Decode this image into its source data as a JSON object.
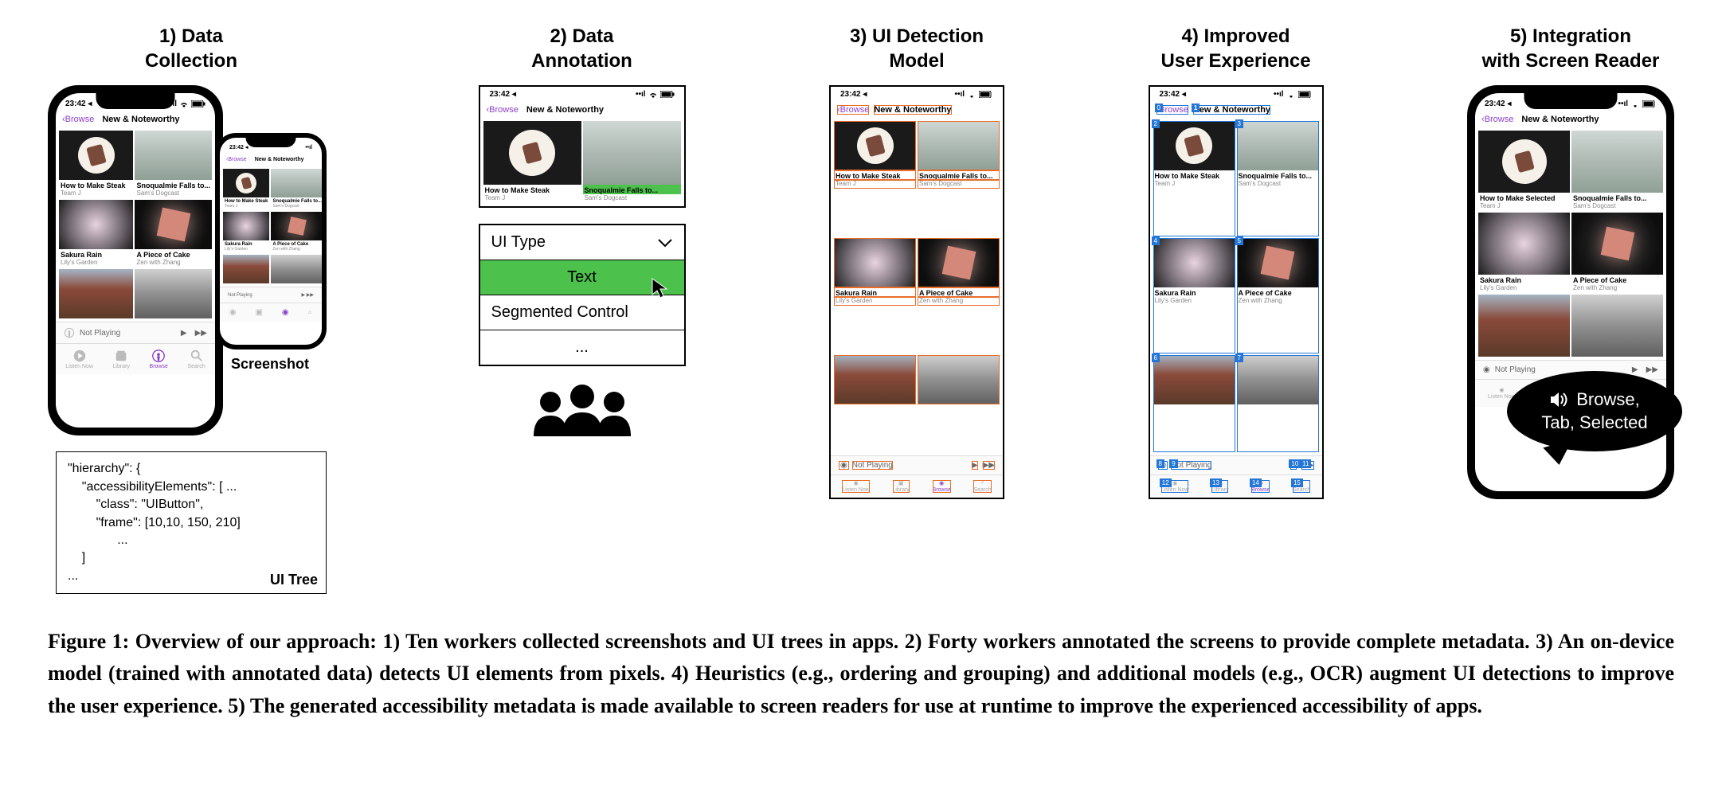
{
  "headers": {
    "c1": "1) Data\nCollection",
    "c2": "2) Data\nAnnotation",
    "c3": "3) UI Detection\nModel",
    "c4": "4) Improved\nUser Experience",
    "c5": "5) Integration\nwith Screen Reader"
  },
  "status": {
    "time": "23:42 ◂",
    "signal": "••ıl",
    "wifi": "⌃",
    "battery": "■"
  },
  "nav": {
    "back": "Browse",
    "title": "New & Noteworthy"
  },
  "cells": [
    {
      "title": "How to Make Steak",
      "sub": "Team J"
    },
    {
      "title": "Snoqualmie Falls to...",
      "sub": "Sam's Dogcast"
    },
    {
      "title": "Sakura Rain",
      "sub": "Lily's Garden"
    },
    {
      "title": "A Piece of Cake",
      "sub": "Zen with Zhang"
    }
  ],
  "cells_sel": {
    "title": "How to Make Selected",
    "sub": "Team J"
  },
  "now_playing": "Not Playing",
  "tabs": [
    {
      "label": "Listen Now"
    },
    {
      "label": "Library"
    },
    {
      "label": "Browse"
    },
    {
      "label": "Search"
    }
  ],
  "screenshot_label": "Screenshot",
  "ui_tree": {
    "line1": "\"hierarchy\": {",
    "line2": "    \"accessibilityElements\": [ ...",
    "line3": "        \"class\": \"UIButton\",",
    "line4": "        \"frame\": [10,10, 150, 210]",
    "line5": "              ...",
    "line6": "    ]",
    "line7": "...",
    "label": "UI Tree"
  },
  "dropdown": {
    "header": "UI Type",
    "option_text": "Text",
    "option_segmented": "Segmented Control",
    "more": "..."
  },
  "numbers": {
    "n0": "0",
    "n1": "1",
    "n2": "2",
    "n3": "3",
    "n4": "4",
    "n5": "5",
    "n6": "6",
    "n7": "7",
    "n8": "8",
    "n9": "9",
    "n10": "10",
    "n11": "11",
    "n12": "12",
    "n13": "13",
    "n14": "14",
    "n15": "15"
  },
  "bubble": {
    "line1": "Browse,",
    "line2": "Tab, Selected"
  },
  "caption_prefix": "Figure 1: Overview of our approach: ",
  "caption_body": "1) Ten workers collected screenshots and UI trees in apps. 2) Forty workers annotated the screens to provide complete metadata. 3) An on-device model (trained with annotated data) detects UI elements from pixels. 4) Heuristics (e.g., ordering and grouping) and additional models (e.g., OCR) augment UI detections to improve the user experience. 5) The generated accessibility metadata is made available to screen readers for use at runtime to improve the experienced accessibility of apps."
}
